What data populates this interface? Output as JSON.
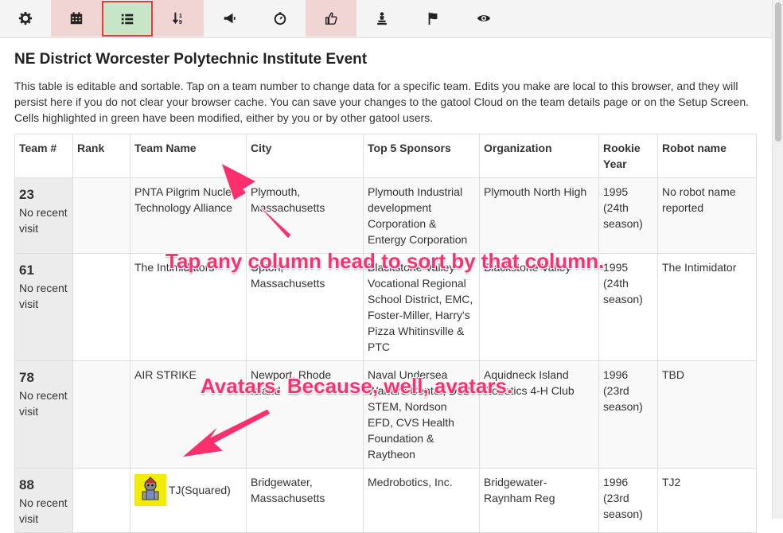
{
  "toolbar": {
    "buttons": [
      {
        "icon": "gear-icon"
      },
      {
        "icon": "calendar-icon"
      },
      {
        "icon": "list-icon"
      },
      {
        "icon": "sort-icon"
      },
      {
        "icon": "megaphone-icon"
      },
      {
        "icon": "stopwatch-icon"
      },
      {
        "icon": "thumbs-up-icon"
      },
      {
        "icon": "chess-icon"
      },
      {
        "icon": "flag-icon"
      },
      {
        "icon": "eye-icon"
      }
    ],
    "highlight_color": "#f1d4d4",
    "active_color": "#c7e6c7"
  },
  "page": {
    "title": "NE District Worcester Polytechnic Institute Event",
    "intro": "This table is editable and sortable. Tap on a team number to change data for a specific team. Edits you make are local to this browser, and they will persist here if you do not clear your browser cache. You can save your changes to the gatool Cloud on the team details page or on the Setup Screen. Cells highlighted in green have been modified, either by you or by other gatool users."
  },
  "table": {
    "headers": [
      "Team #",
      "Rank",
      "Team Name",
      "City",
      "Top 5 Sponsors",
      "Organization",
      "Rookie Year",
      "Robot name"
    ],
    "rows": [
      {
        "team": "23",
        "visit": "No recent visit",
        "rank": "",
        "name": "PNTA Pilgrim Nuclear Technology Alliance",
        "city": "Plymouth, Massachusetts",
        "sponsors": "Plymouth Industrial development Corporation & Entergy Corporation",
        "org": "Plymouth North High",
        "rookie": "1995 (24th season)",
        "robot": "No robot name reported"
      },
      {
        "team": "61",
        "visit": "No recent visit",
        "rank": "",
        "name": "The Intimidators",
        "city": "Upton, Massachusetts",
        "sponsors": "Blackstone Valley Vocational Regional School District, EMC, Foster-Miller, Harry's Pizza Whitinsville & PTC",
        "org": "Blackstone Valley",
        "rookie": "1995 (24th season)",
        "robot": "The Intimidator"
      },
      {
        "team": "78",
        "visit": "No recent visit",
        "rank": "",
        "name": "AIR STRIKE",
        "city": "Newport, Rhode Island",
        "sponsors": "Naval Undersea Warfare Center, DoD STEM, Nordson EFD, CVS Health Foundation & Raytheon",
        "org": "Aquidneck Island Robotics 4-H Club",
        "rookie": "1996 (23rd season)",
        "robot": "TBD"
      },
      {
        "team": "88",
        "visit": "No recent visit",
        "rank": "",
        "name": "TJ(Squared)",
        "city": "Bridgewater, Massachusetts",
        "sponsors": "Medrobotics, Inc.",
        "org": "Bridgewater-Raynham Reg",
        "rookie": "1996 (23rd season)",
        "robot": "TJ2"
      }
    ]
  },
  "annotations": {
    "sort_hint": "Tap any column head to sort by that column.",
    "avatar_hint": "Avatars. Because, well, avatars.",
    "color": "#ff2e6c"
  }
}
